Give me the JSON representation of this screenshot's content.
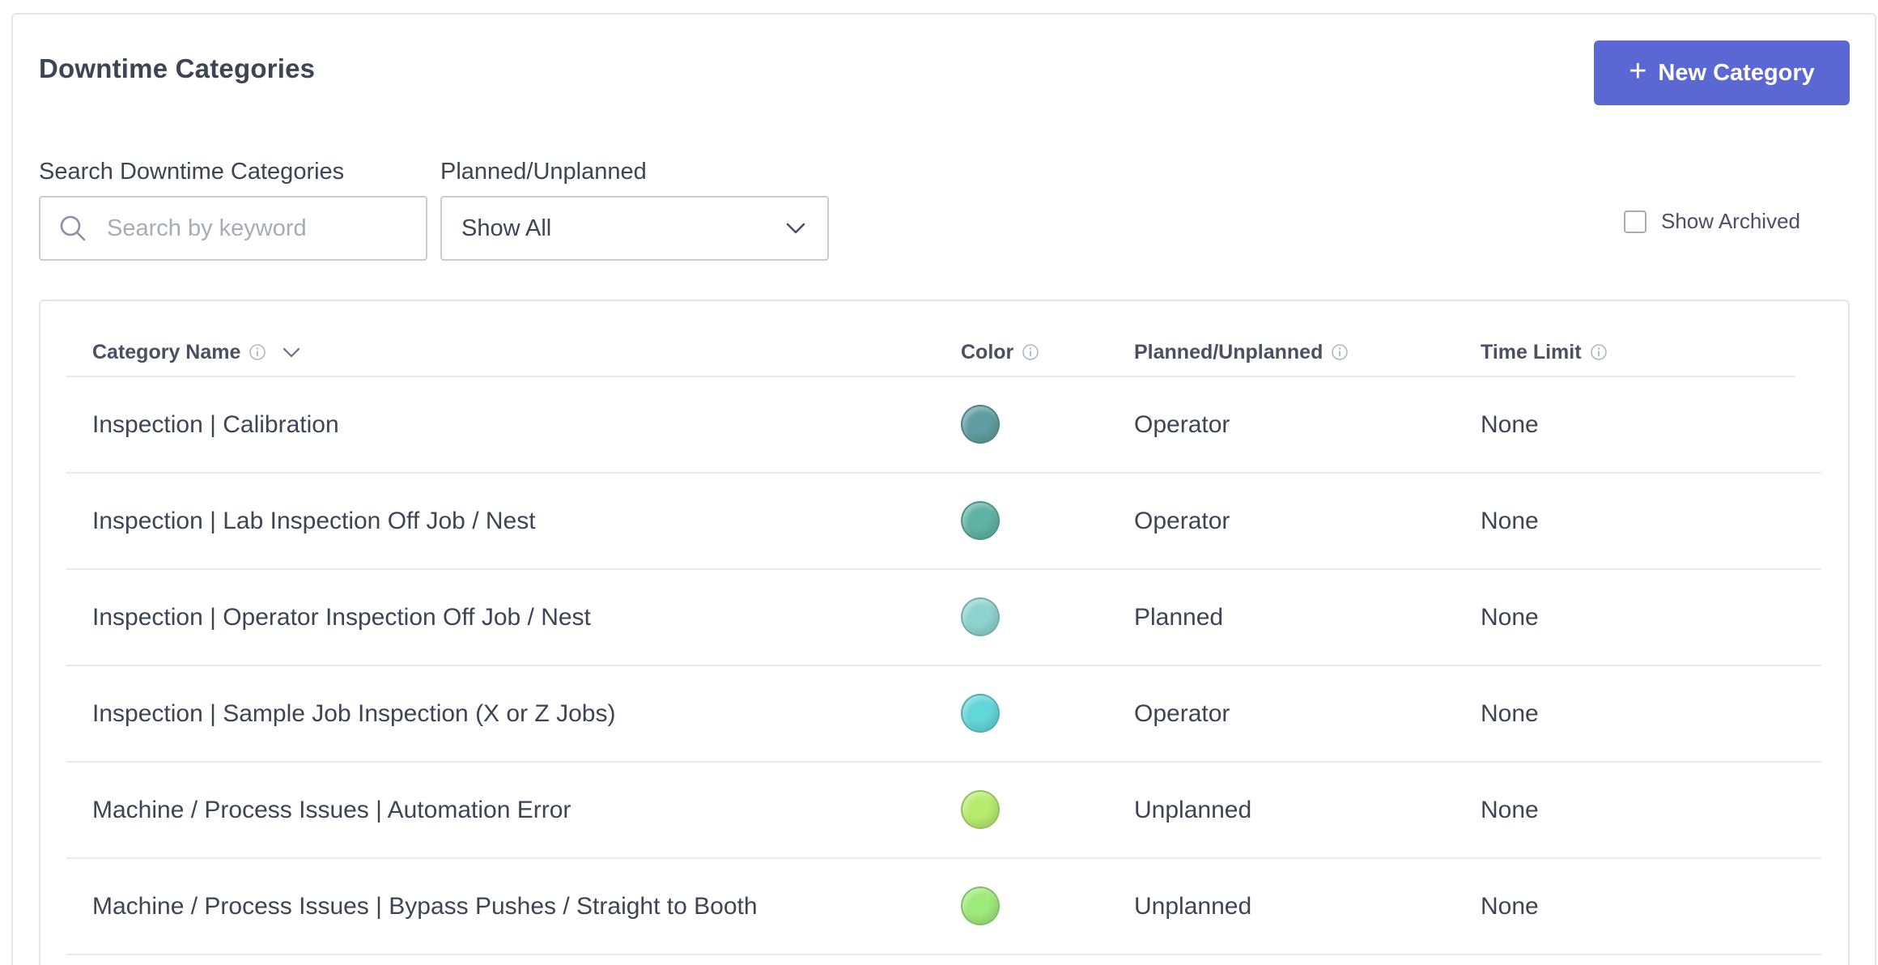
{
  "header": {
    "title": "Downtime Categories",
    "new_button_label": "New Category",
    "new_button_icon": "plus-icon"
  },
  "filters": {
    "search_label": "Search Downtime Categories",
    "search_placeholder": "Search by keyword",
    "search_value": "",
    "type_label": "Planned/Unplanned",
    "type_selected": "Show All",
    "show_archived_label": "Show Archived",
    "show_archived_checked": false
  },
  "table": {
    "columns": {
      "name": "Category Name",
      "color": "Color",
      "type": "Planned/Unplanned",
      "limit": "Time Limit"
    },
    "rows": [
      {
        "name": "Inspection | Calibration",
        "color": "#5f9ea0",
        "type": "Operator",
        "limit": "None"
      },
      {
        "name": "Inspection | Lab Inspection Off Job / Nest",
        "color": "#5fb3a3",
        "type": "Operator",
        "limit": "None"
      },
      {
        "name": "Inspection | Operator Inspection Off Job / Nest",
        "color": "#8fd3cf",
        "type": "Planned",
        "limit": "None"
      },
      {
        "name": "Inspection | Sample Job Inspection (X or Z Jobs)",
        "color": "#63d6da",
        "type": "Operator",
        "limit": "None"
      },
      {
        "name": "Machine / Process Issues | Automation Error",
        "color": "#b6ec6e",
        "type": "Unplanned",
        "limit": "None"
      },
      {
        "name": "Machine / Process Issues | Bypass Pushes / Straight to Booth",
        "color": "#9eea7a",
        "type": "Unplanned",
        "limit": "None"
      }
    ]
  },
  "colors": {
    "accent": "#5b67d2",
    "text": "#3d4453",
    "border": "#c9ccd6"
  }
}
